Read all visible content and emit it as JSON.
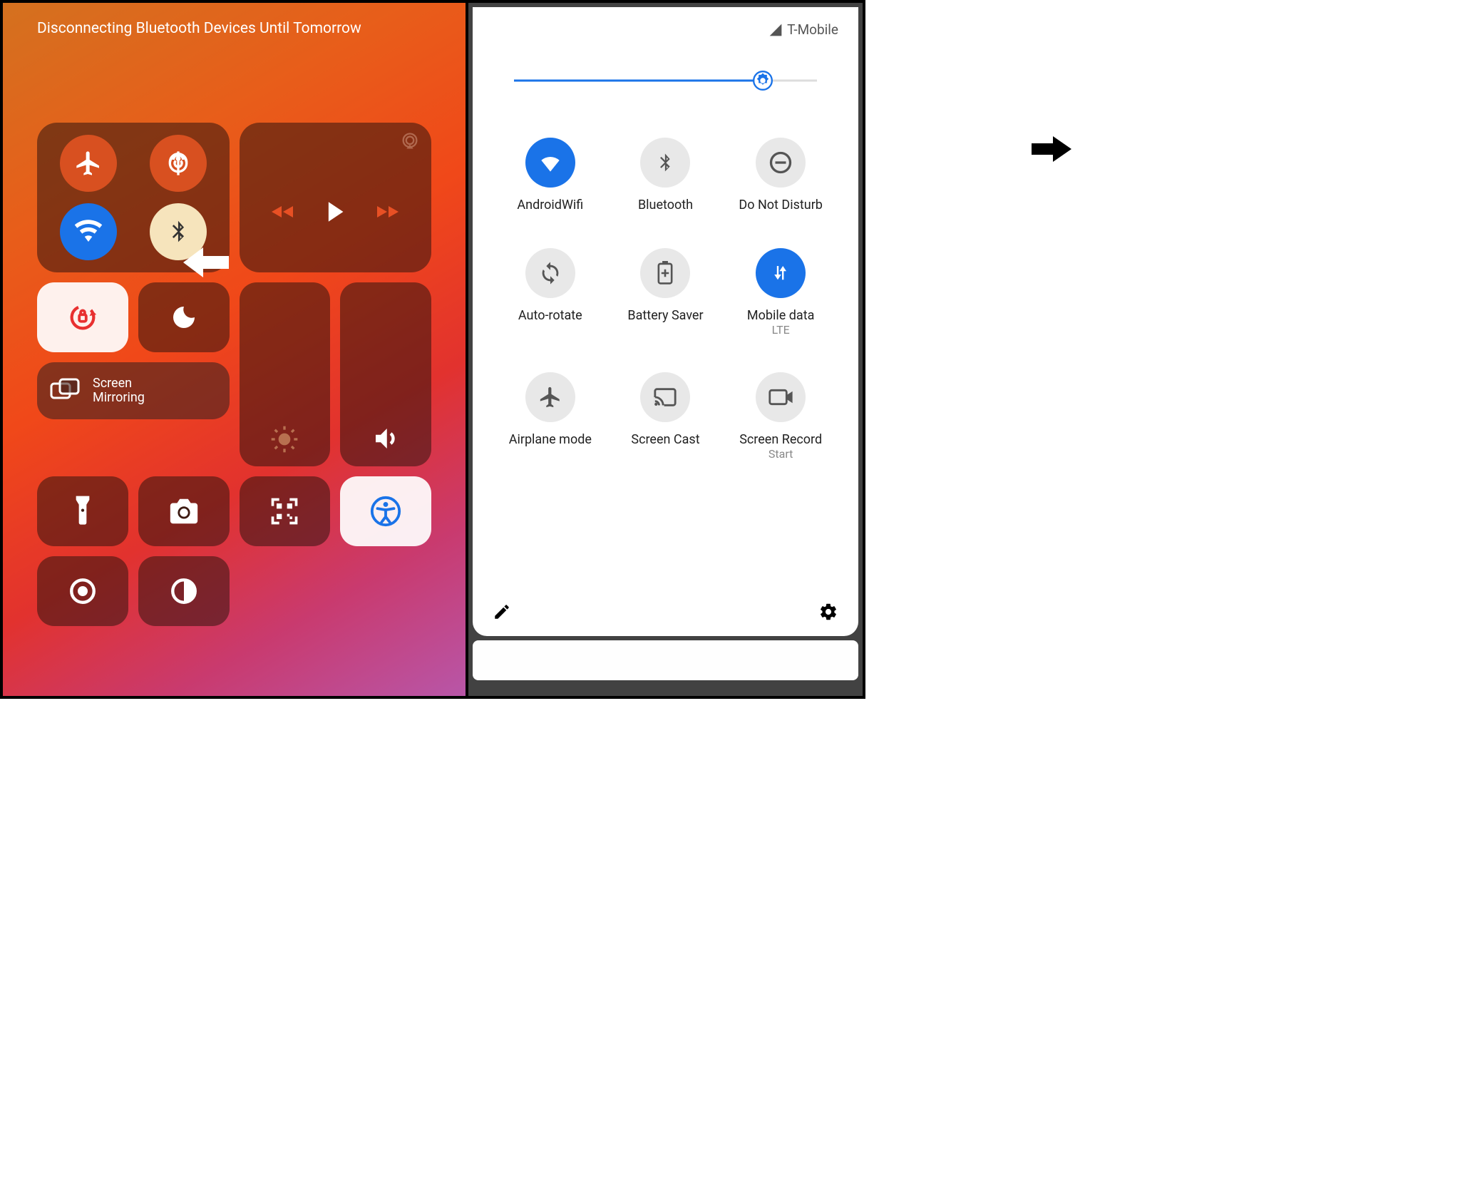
{
  "ios": {
    "toast": "Disconnecting Bluetooth Devices Until Tomorrow",
    "screenMirror": {
      "line1": "Screen",
      "line2": "Mirroring"
    }
  },
  "android": {
    "carrier": "T-Mobile",
    "brightness_pct": 82,
    "tiles": [
      {
        "label": "AndroidWifi",
        "sub": "",
        "on": true,
        "icon": "wifi"
      },
      {
        "label": "Bluetooth",
        "sub": "",
        "on": false,
        "icon": "bluetooth"
      },
      {
        "label": "Do Not Disturb",
        "sub": "",
        "on": false,
        "icon": "dnd"
      },
      {
        "label": "Auto-rotate",
        "sub": "",
        "on": false,
        "icon": "rotate"
      },
      {
        "label": "Battery Saver",
        "sub": "",
        "on": false,
        "icon": "battery"
      },
      {
        "label": "Mobile data",
        "sub": "LTE",
        "on": true,
        "icon": "data"
      },
      {
        "label": "Airplane mode",
        "sub": "",
        "on": false,
        "icon": "airplane"
      },
      {
        "label": "Screen Cast",
        "sub": "",
        "on": false,
        "icon": "cast"
      },
      {
        "label": "Screen Record",
        "sub": "Start",
        "on": false,
        "icon": "record"
      }
    ]
  }
}
